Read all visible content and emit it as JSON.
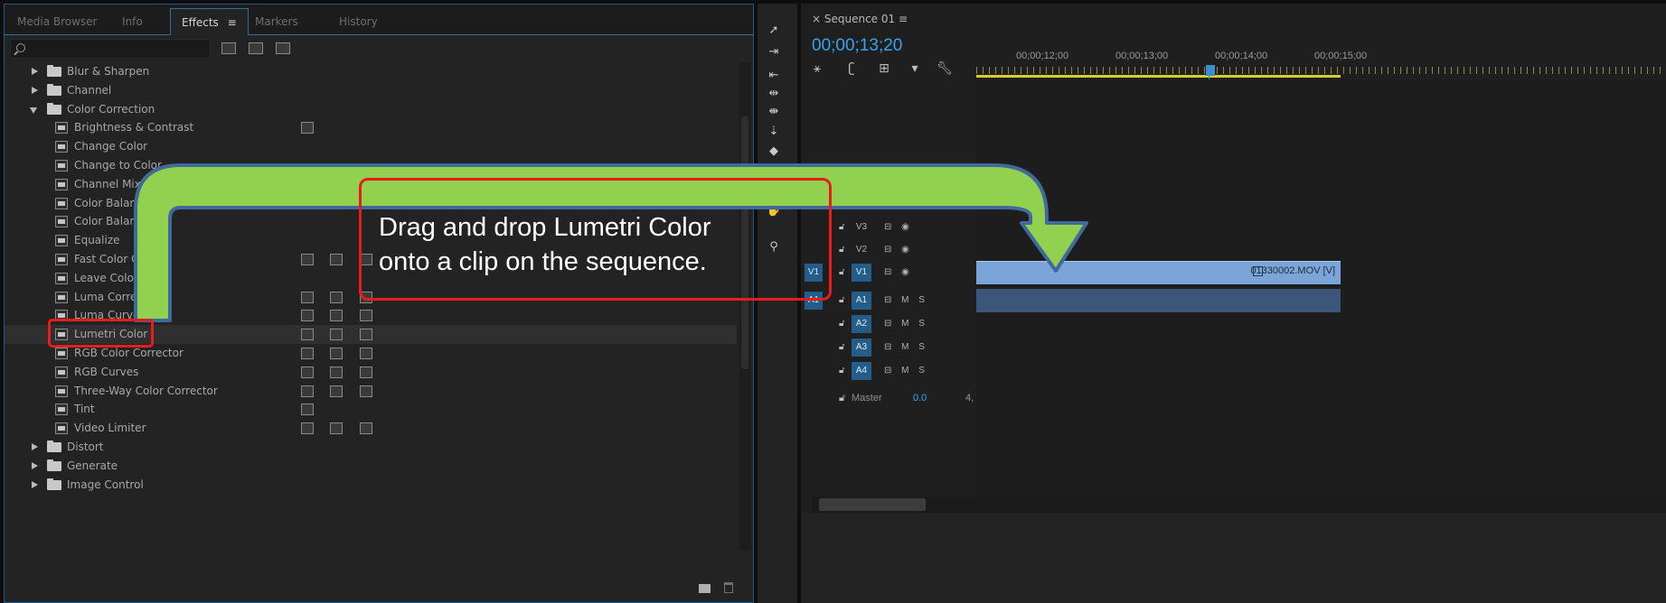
{
  "effects_panel": {
    "tabs": [
      {
        "label": "Media Browser",
        "active": false
      },
      {
        "label": "Info",
        "active": false
      },
      {
        "label": "Effects",
        "active": true,
        "menu_glyph": "≡"
      },
      {
        "label": "Markers",
        "active": false
      },
      {
        "label": "History",
        "active": false
      }
    ],
    "search": {
      "value": "",
      "placeholder": ""
    },
    "filter_badges": [
      "accelerated-effects-icon",
      "32-bit-effects-icon",
      "yuv-effects-icon"
    ],
    "tree": [
      {
        "type": "folder",
        "label": "Blur & Sharpen",
        "expanded": false
      },
      {
        "type": "folder",
        "label": "Channel",
        "expanded": false
      },
      {
        "type": "folder",
        "label": "Color Correction",
        "expanded": true
      },
      {
        "type": "effect",
        "label": "Brightness & Contrast",
        "badges": [
          1
        ]
      },
      {
        "type": "effect",
        "label": "Change Color",
        "badges": []
      },
      {
        "type": "effect",
        "label": "Change to Color",
        "badges": []
      },
      {
        "type": "effect",
        "label": "Channel Mixer",
        "badges": []
      },
      {
        "type": "effect",
        "label": "Color Balance",
        "badges": []
      },
      {
        "type": "effect",
        "label": "Color Balance",
        "badges": []
      },
      {
        "type": "effect",
        "label": "Equalize",
        "badges": []
      },
      {
        "type": "effect",
        "label": "Fast Color Co",
        "badges": [
          1,
          2,
          3
        ]
      },
      {
        "type": "effect",
        "label": "Leave Color",
        "badges": []
      },
      {
        "type": "effect",
        "label": "Luma Correct",
        "badges": [
          1,
          2,
          3
        ]
      },
      {
        "type": "effect",
        "label": "Luma Curve",
        "badges": [
          1,
          2,
          3
        ]
      },
      {
        "type": "effect",
        "label": "Lumetri Color",
        "badges": [
          1,
          2,
          3
        ],
        "selected": true
      },
      {
        "type": "effect",
        "label": "RGB Color Corrector",
        "badges": [
          1,
          2,
          3
        ]
      },
      {
        "type": "effect",
        "label": "RGB Curves",
        "badges": [
          1,
          2,
          3
        ]
      },
      {
        "type": "effect",
        "label": "Three-Way Color Corrector",
        "badges": [
          1,
          2,
          3
        ]
      },
      {
        "type": "effect",
        "label": "Tint",
        "badges": [
          1
        ]
      },
      {
        "type": "effect",
        "label": "Video Limiter",
        "badges": [
          1,
          2,
          3
        ]
      },
      {
        "type": "folder",
        "label": "Distort",
        "expanded": false
      },
      {
        "type": "folder",
        "label": "Generate",
        "expanded": false
      },
      {
        "type": "folder",
        "label": "Image Control",
        "expanded": false
      }
    ]
  },
  "timeline": {
    "sequence_tab": "× Sequence 01 ≡",
    "timecode": "00;00;13;20",
    "ruler_labels": [
      "00;00;12;00",
      "00;00;13;00",
      "00;00;14;00",
      "00;00;15;00"
    ],
    "tracks": [
      {
        "name": "V3",
        "kind": "video",
        "source_patch": "",
        "targeted": false
      },
      {
        "name": "V2",
        "kind": "video",
        "source_patch": "",
        "targeted": false
      },
      {
        "name": "V1",
        "kind": "video",
        "source_patch": "V1",
        "targeted": true
      },
      {
        "name": "A1",
        "kind": "audio",
        "source_patch": "A1",
        "targeted": true
      },
      {
        "name": "A2",
        "kind": "audio",
        "source_patch": "",
        "targeted": true
      },
      {
        "name": "A3",
        "kind": "audio",
        "source_patch": "",
        "targeted": true
      },
      {
        "name": "A4",
        "kind": "audio",
        "source_patch": "",
        "targeted": true
      }
    ],
    "master": {
      "label": "Master",
      "value": "0.0",
      "extra": "4,"
    },
    "clip": {
      "name": "01330002.MOV [V]",
      "color": "#7ba5d8",
      "audio_color": "#3b5678"
    }
  },
  "annotation": {
    "callout_line1": "Drag and drop Lumetri Color",
    "callout_line2": "onto a clip on the sequence.",
    "highlight_color": "#e81c1c",
    "arrow_color": "#92d050"
  },
  "colors": {
    "accent_blue": "#2d6fa3",
    "timecode_blue": "#36a3ef",
    "workarea_yellow": "#d8cf2b"
  }
}
